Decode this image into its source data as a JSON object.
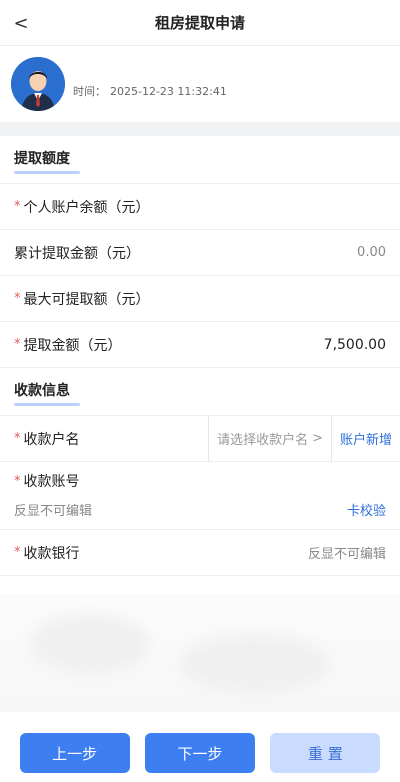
{
  "header": {
    "title": "租房提取申请",
    "back_glyph": "<"
  },
  "user": {
    "time_label": "时间：",
    "time_value": "2025-12-23 11:32:41"
  },
  "sections": {
    "extract": {
      "title": "提取额度",
      "rows": [
        {
          "label": "个人账户余额（元）",
          "required": true,
          "value": ""
        },
        {
          "label": "累计提取金额（元）",
          "required": false,
          "value": "0.00"
        },
        {
          "label": "最大可提取额（元）",
          "required": true,
          "value": ""
        },
        {
          "label": "提取金额（元）",
          "required": true,
          "value": "7,500.00"
        }
      ]
    },
    "payee": {
      "title": "收款信息",
      "name_label": "收款户名",
      "name_placeholder": "请选择收款户名",
      "name_chevron": ">",
      "add_account": "账户新增",
      "account_label": "收款账号",
      "account_value": "反显不可编辑",
      "card_verify": "卡校验",
      "bank_label": "收款银行",
      "bank_value": "反显不可编辑"
    }
  },
  "footer": {
    "prev": "上一步",
    "next": "下一步",
    "reset": "重 置"
  },
  "colors": {
    "accent": "#3d7ff0",
    "required": "#e15a5a",
    "link": "#2d6fdc"
  }
}
